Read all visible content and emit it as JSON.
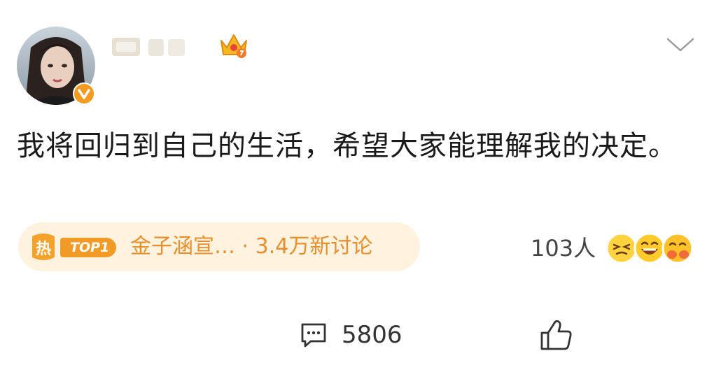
{
  "post": {
    "text": "我将回归到自己的生活，希望大家能理解我的决定。"
  },
  "hot_topic": {
    "rank_label": "TOP1",
    "text": "金子涵宣… · 3.4万新讨论",
    "icon": "hot-flame-icon"
  },
  "reactions": {
    "count": "103人"
  },
  "actions": {
    "comment_count": "5806"
  },
  "colors": {
    "accent": "#f29a26",
    "pill_bg": "#fff2df",
    "topic_text": "#e88e2a",
    "badge": "#f39a1f"
  }
}
